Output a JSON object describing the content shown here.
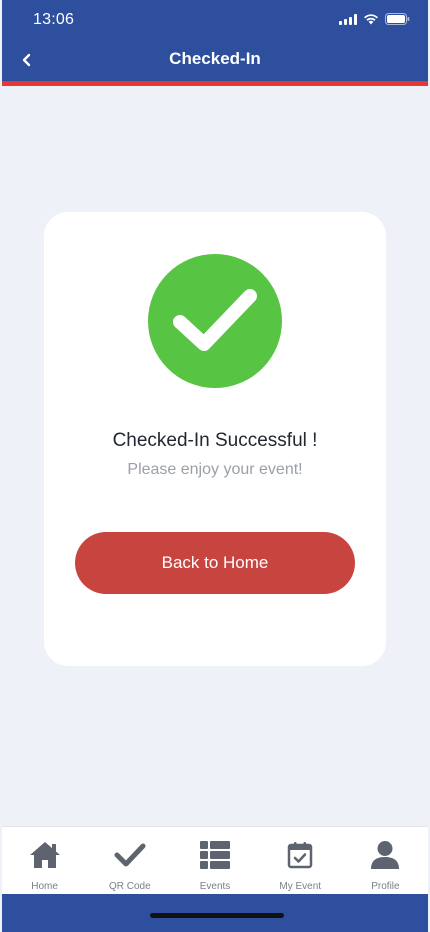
{
  "status_bar": {
    "time": "13:06"
  },
  "header": {
    "title": "Checked-In"
  },
  "card": {
    "title": "Checked-In Successful !",
    "subtitle": "Please enjoy your event!",
    "button_label": "Back to Home"
  },
  "bottom_nav": {
    "items": [
      {
        "label": "Home",
        "icon": "home-icon"
      },
      {
        "label": "QR Code",
        "icon": "check-icon"
      },
      {
        "label": "Events",
        "icon": "list-icon"
      },
      {
        "label": "My Event",
        "icon": "calendar-check-icon"
      },
      {
        "label": "Profile",
        "icon": "person-icon"
      }
    ]
  },
  "colors": {
    "header": "#2e4f9e",
    "accent": "#e53935",
    "success": "#58c443",
    "button": "#c8443f",
    "nav_icon": "#5d6470"
  }
}
